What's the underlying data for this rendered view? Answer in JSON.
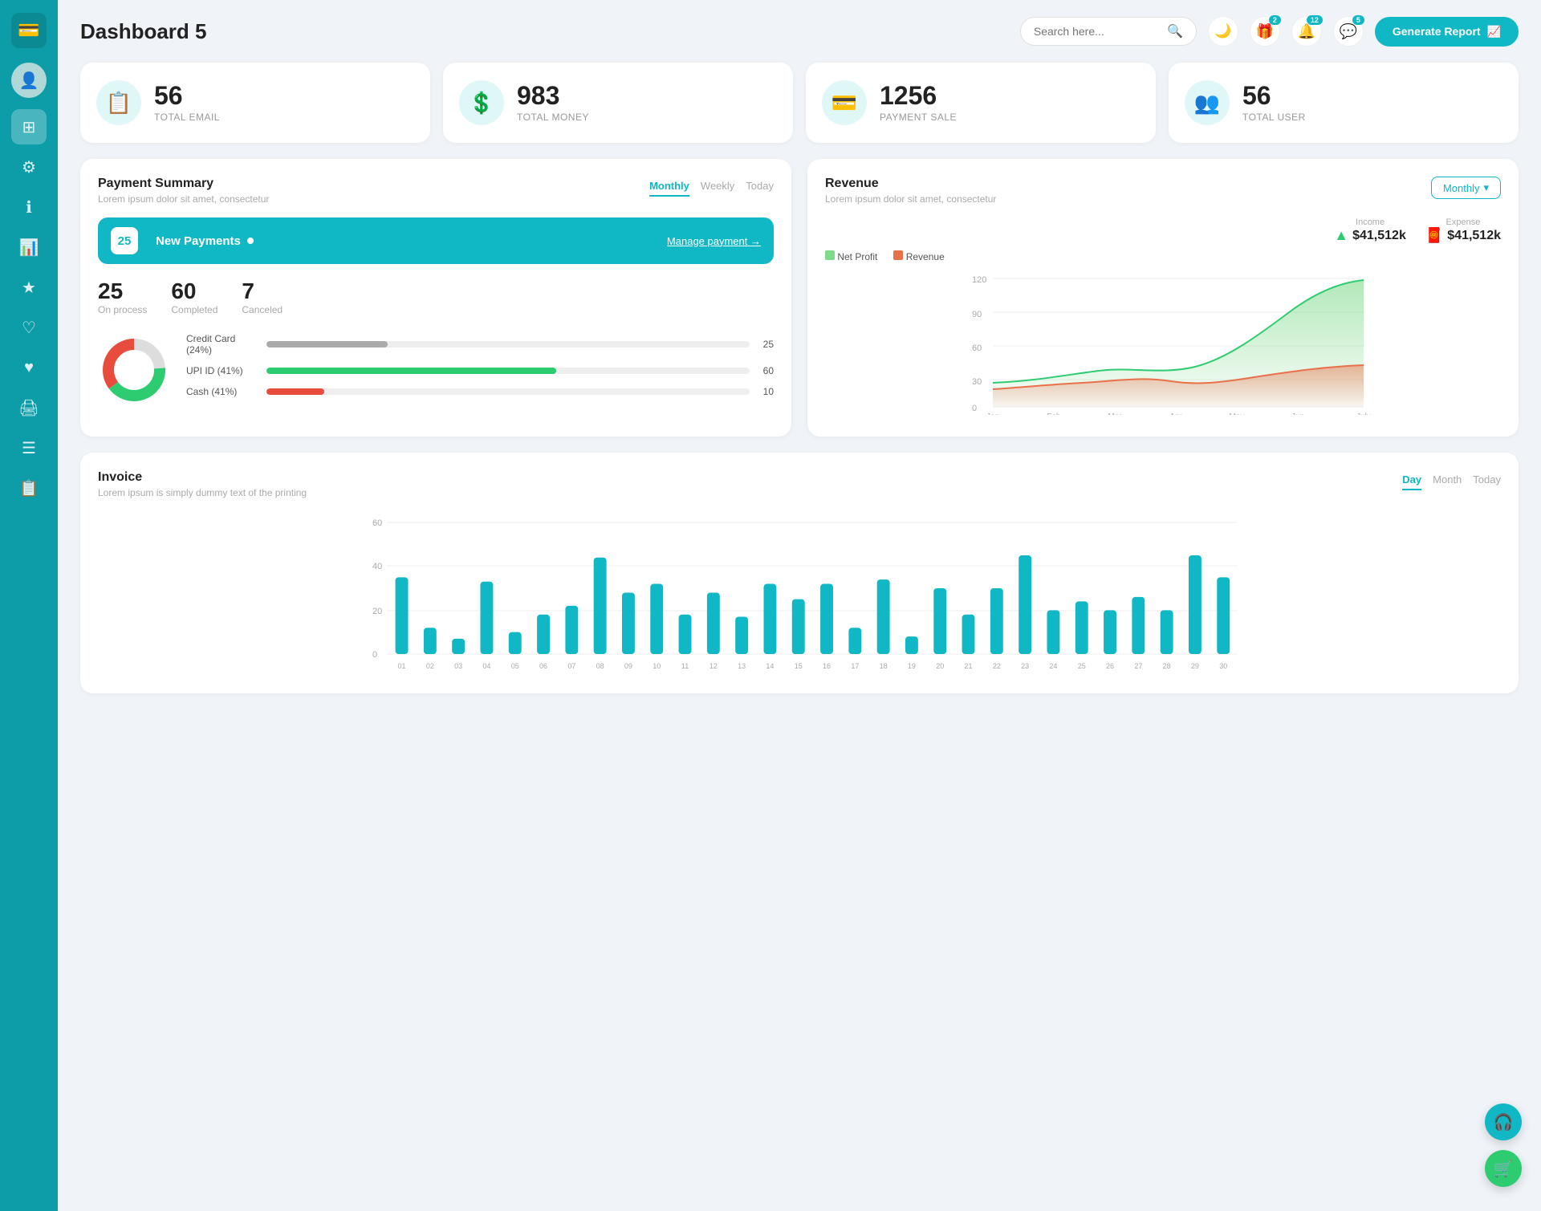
{
  "sidebar": {
    "logo_icon": "💳",
    "avatar_icon": "👤",
    "items": [
      {
        "id": "dashboard",
        "icon": "⊞",
        "active": true
      },
      {
        "id": "settings",
        "icon": "⚙"
      },
      {
        "id": "info",
        "icon": "ℹ"
      },
      {
        "id": "analytics",
        "icon": "📊"
      },
      {
        "id": "star",
        "icon": "★"
      },
      {
        "id": "heart-outline",
        "icon": "♡"
      },
      {
        "id": "heart-filled",
        "icon": "♥"
      },
      {
        "id": "print",
        "icon": "🖨"
      },
      {
        "id": "list",
        "icon": "☰"
      },
      {
        "id": "report",
        "icon": "📋"
      }
    ]
  },
  "header": {
    "title": "Dashboard 5",
    "search_placeholder": "Search here...",
    "dark_toggle_icon": "🌙",
    "notifications_badge": "2",
    "alerts_badge": "12",
    "messages_badge": "5",
    "generate_btn_label": "Generate Report"
  },
  "stats": [
    {
      "id": "email",
      "number": "56",
      "label": "TOTAL EMAIL",
      "icon": "📋"
    },
    {
      "id": "money",
      "number": "983",
      "label": "TOTAL MONEY",
      "icon": "💲"
    },
    {
      "id": "payment",
      "number": "1256",
      "label": "PAYMENT SALE",
      "icon": "💳"
    },
    {
      "id": "user",
      "number": "56",
      "label": "TOTAL USER",
      "icon": "👥"
    }
  ],
  "payment_summary": {
    "title": "Payment Summary",
    "subtitle": "Lorem ipsum dolor sit amet, consectetur",
    "tabs": [
      "Monthly",
      "Weekly",
      "Today"
    ],
    "active_tab": "Monthly",
    "new_payments_count": "25",
    "new_payments_label": "New Payments",
    "manage_link": "Manage payment",
    "stats": [
      {
        "number": "25",
        "label": "On process"
      },
      {
        "number": "60",
        "label": "Completed"
      },
      {
        "number": "7",
        "label": "Canceled"
      }
    ],
    "progress_items": [
      {
        "label": "Credit Card (24%)",
        "value": 25,
        "color": "#aaa",
        "count": "25"
      },
      {
        "label": "UPI ID (41%)",
        "value": 60,
        "color": "#2ecc71",
        "count": "60"
      },
      {
        "label": "Cash (41%)",
        "value": 10,
        "color": "#e74c3c",
        "count": "10"
      }
    ],
    "donut": {
      "gray_pct": 24,
      "green_pct": 41,
      "red_pct": 35
    }
  },
  "revenue": {
    "title": "Revenue",
    "subtitle": "Lorem ipsum dolor sit amet, consectetur",
    "dropdown_label": "Monthly",
    "income_label": "Income",
    "income_value": "$41,512k",
    "expense_label": "Expense",
    "expense_value": "$41,512k",
    "legend": [
      {
        "label": "Net Profit",
        "color": "#7fda8a"
      },
      {
        "label": "Revenue",
        "color": "#e8714a"
      }
    ],
    "x_labels": [
      "Jan",
      "Feb",
      "Mar",
      "Apr",
      "May",
      "Jun",
      "July"
    ],
    "y_labels": [
      "0",
      "30",
      "60",
      "90",
      "120"
    ]
  },
  "invoice": {
    "title": "Invoice",
    "subtitle": "Lorem ipsum is simply dummy text of the printing",
    "tabs": [
      "Day",
      "Month",
      "Today"
    ],
    "active_tab": "Day",
    "y_labels": [
      "0",
      "20",
      "40",
      "60"
    ],
    "x_labels": [
      "01",
      "02",
      "03",
      "04",
      "05",
      "06",
      "07",
      "08",
      "09",
      "10",
      "11",
      "12",
      "13",
      "14",
      "15",
      "16",
      "17",
      "18",
      "19",
      "20",
      "21",
      "22",
      "23",
      "24",
      "25",
      "26",
      "27",
      "28",
      "29",
      "30"
    ],
    "bar_values": [
      35,
      12,
      7,
      33,
      10,
      18,
      22,
      44,
      28,
      32,
      18,
      28,
      17,
      32,
      25,
      32,
      12,
      34,
      8,
      30,
      18,
      30,
      45,
      20,
      24,
      20,
      26,
      20,
      45,
      35
    ]
  },
  "fab": [
    {
      "id": "support",
      "icon": "🎧",
      "color_class": "fab-teal"
    },
    {
      "id": "cart",
      "icon": "🛒",
      "color_class": "fab-green"
    }
  ]
}
